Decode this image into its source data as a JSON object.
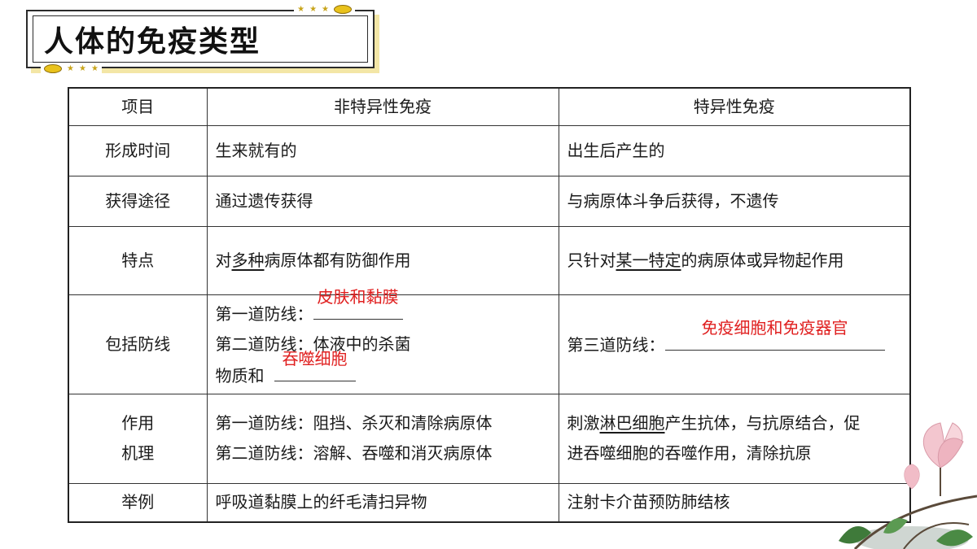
{
  "title": "人体的免疫类型",
  "table": {
    "headers": [
      "项目",
      "非特异性免疫",
      "特异性免疫"
    ],
    "rows": [
      {
        "item": "形成时间",
        "nonspecific": "生来就有的",
        "specific": "出生后产生的"
      },
      {
        "item": "获得途径",
        "nonspecific": "通过遗传获得",
        "specific": "与病原体斗争后获得，不遗传"
      },
      {
        "item": "特点",
        "nonspecific": {
          "pre": "对",
          "underlined": "多种",
          "post": "病原体都有防御作用"
        },
        "specific": {
          "pre": "只针对",
          "underlined": "某一特定",
          "post": "的病原体或异物起作用"
        }
      },
      {
        "item": "包括防线",
        "nonspecific": {
          "line1_label": "第一道防线：",
          "line1_answer": "皮肤和黏膜",
          "line2_text": "第二道防线：体液中的杀菌",
          "line3_label": "物质和",
          "line3_answer": "吞噬细胞"
        },
        "specific": {
          "label": "第三道防线：",
          "answer": "免疫细胞和免疫器官"
        }
      },
      {
        "item_line1": "作用",
        "item_line2": "机理",
        "nonspecific": {
          "line1": "第一道防线：阻挡、杀灭和清除病原体",
          "line2": "第二道防线：溶解、吞噬和消灭病原体"
        },
        "specific": {
          "pre": "刺激",
          "underlined": "淋巴细胞",
          "post": "产生抗体，与抗原结合，促",
          "line2": "进吞噬细胞的吞噬作用，清除抗原"
        }
      },
      {
        "item": "举例",
        "nonspecific": "呼吸道黏膜上的纤毛清扫异物",
        "specific": "注射卡介苗预防肺结核"
      }
    ]
  },
  "colors": {
    "answer": "#e02020",
    "border": "#222222",
    "accent": "#e9c21c"
  },
  "decorations": [
    "star-icon",
    "oval-icon",
    "magnolia-flower-illustration"
  ]
}
